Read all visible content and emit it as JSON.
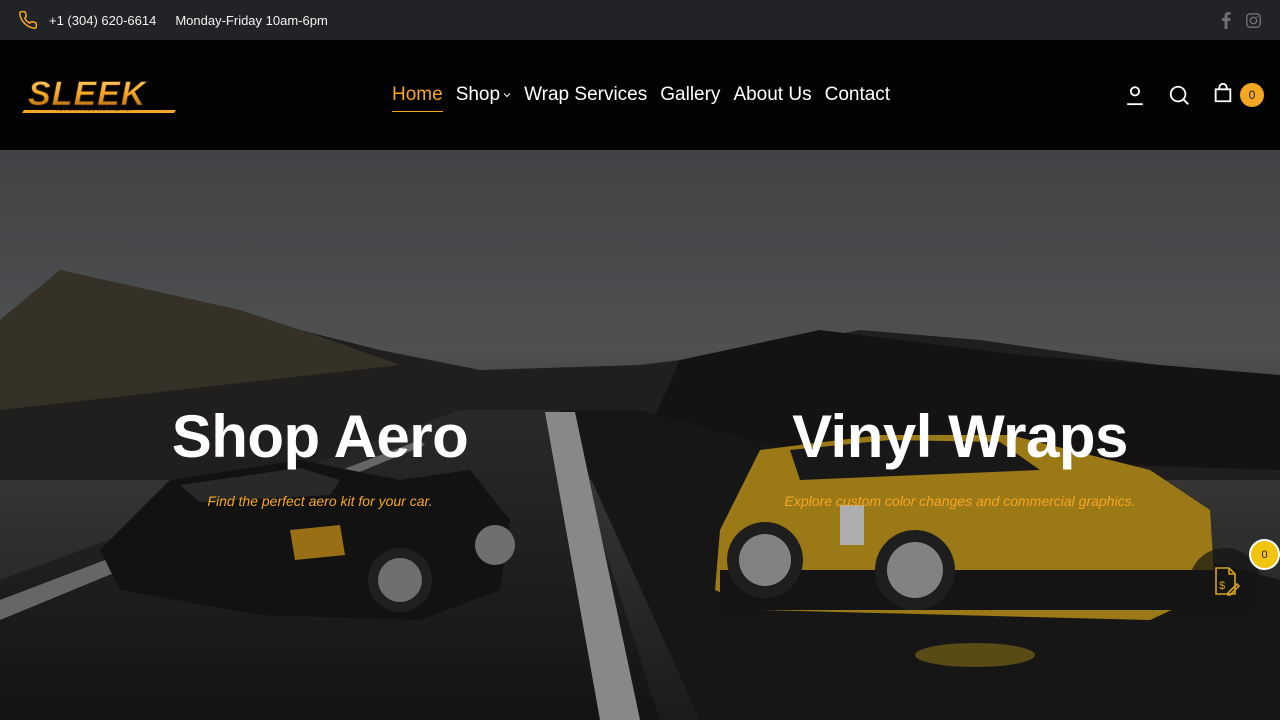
{
  "topbar": {
    "phone": "+1 (304) 620-6614",
    "hours": "Monday-Friday 10am-6pm",
    "social_icons": [
      "facebook-icon",
      "instagram-icon"
    ]
  },
  "logo": {
    "text": "SLEEK",
    "tagline": "PERFORMANCE & CUSTOMIZATION"
  },
  "nav": {
    "items": [
      {
        "label": "Home",
        "active": true
      },
      {
        "label": "Shop",
        "has_dropdown": true
      },
      {
        "label": "Wrap Services"
      },
      {
        "label": "Gallery"
      },
      {
        "label": "About Us"
      },
      {
        "label": "Contact"
      }
    ]
  },
  "header_icons": {
    "account": "user-icon",
    "search": "search-icon",
    "cart": "cart-icon",
    "cart_count": "0"
  },
  "hero": {
    "left": {
      "title": "Shop Aero",
      "subtitle": "Find the perfect aero kit for your car."
    },
    "right": {
      "title": "Vinyl Wraps",
      "subtitle": "Explore custom color changes and commercial graphics."
    }
  },
  "quote_widget": {
    "icon": "quote-document-icon",
    "count": "0"
  },
  "colors": {
    "accent": "#f5a623",
    "topbar_bg": "#222326",
    "header_bg": "#020202"
  }
}
